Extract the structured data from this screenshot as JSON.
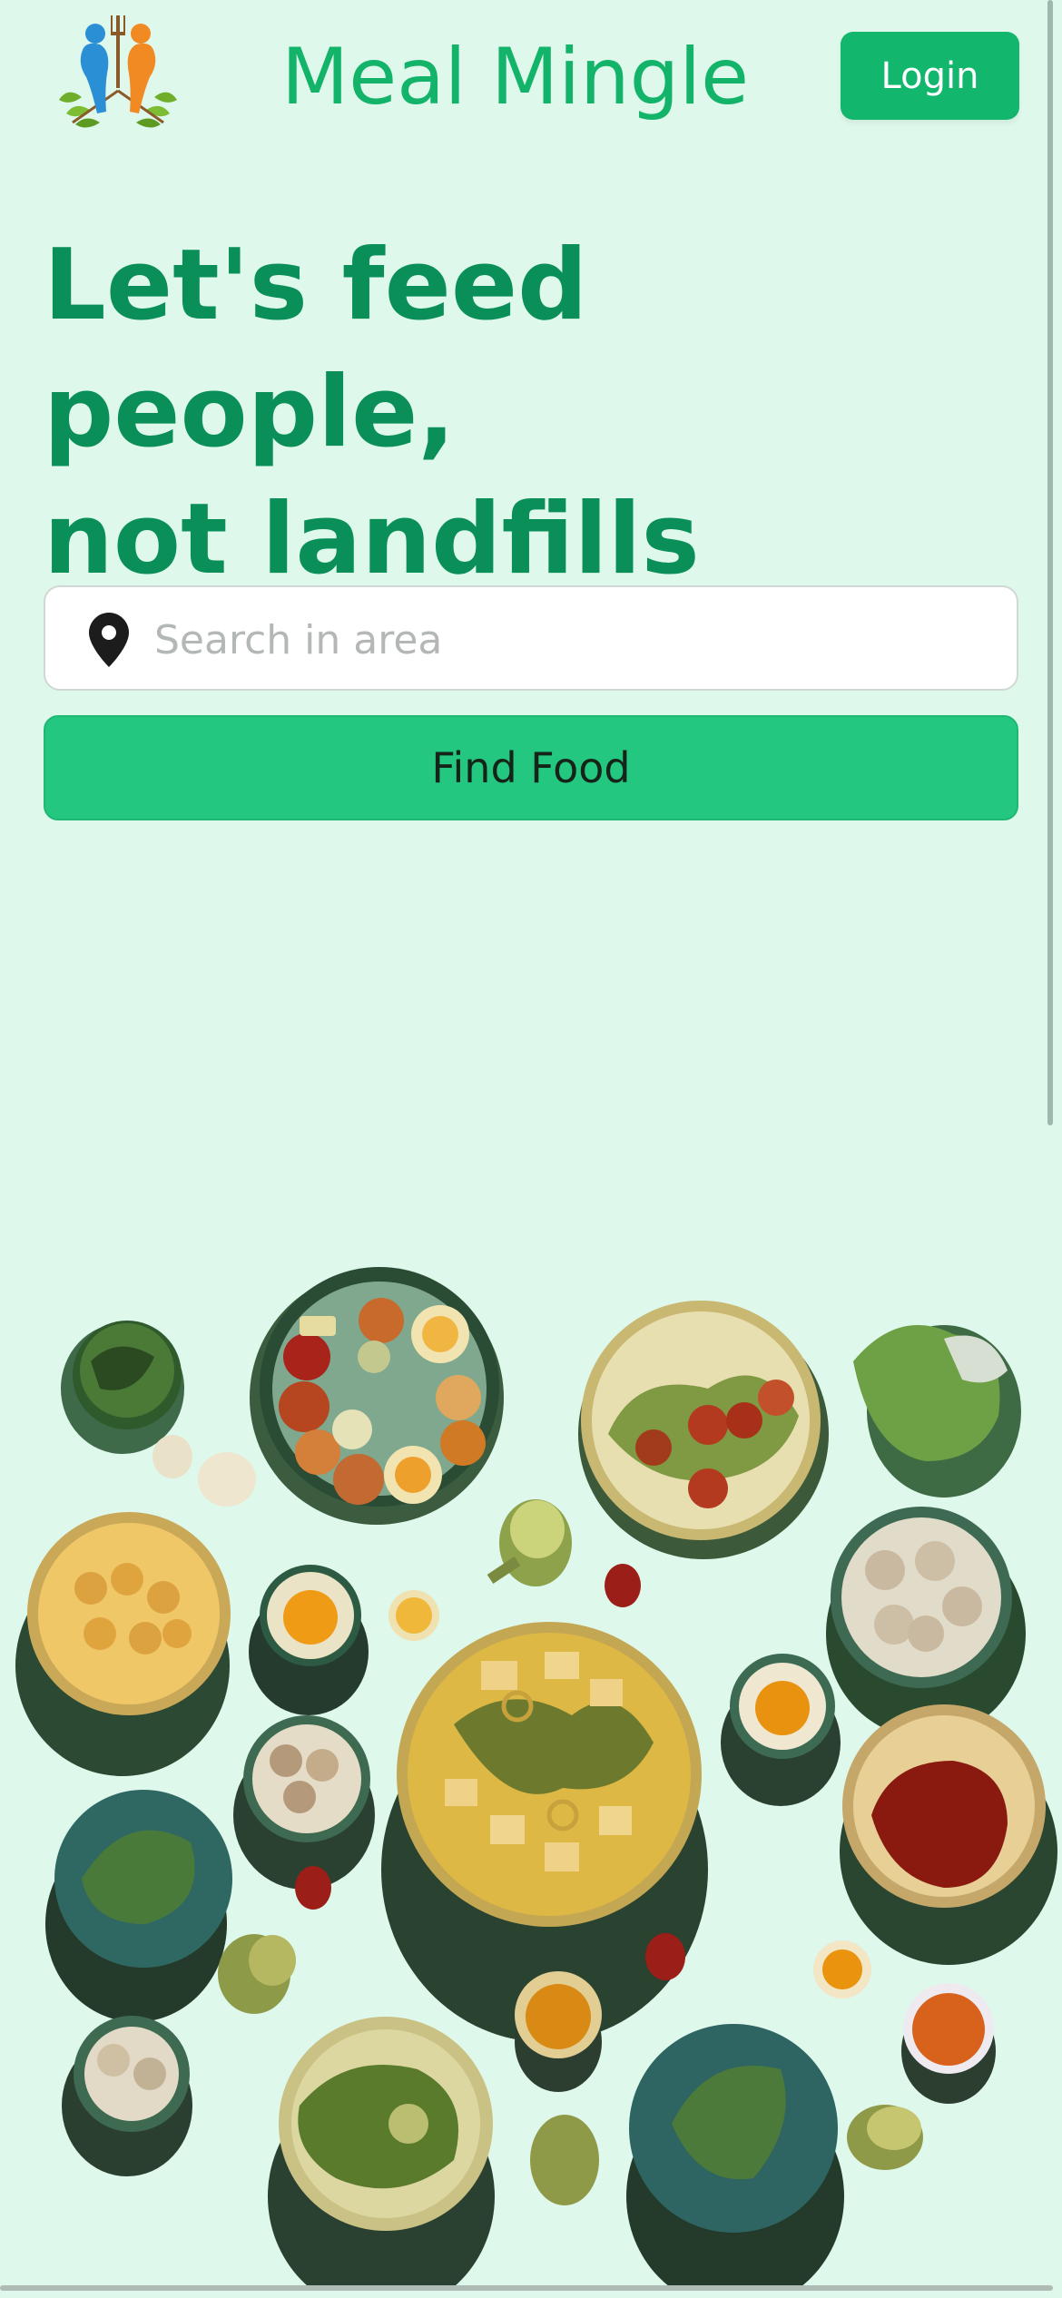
{
  "header": {
    "brand": "Meal Mingle",
    "login_label": "Login",
    "logo_icon": "meal-mingle-logo-icon"
  },
  "hero": {
    "heading_line1": "Let's feed people,",
    "heading_line2": "not landfills"
  },
  "search": {
    "placeholder": "Search in area",
    "value": "",
    "icon": "location-pin-icon"
  },
  "actions": {
    "find_label": "Find Food"
  },
  "colors": {
    "background": "#dff8ec",
    "brand": "#13b46a",
    "heading": "#0b8f58",
    "button": "#24c77f"
  }
}
